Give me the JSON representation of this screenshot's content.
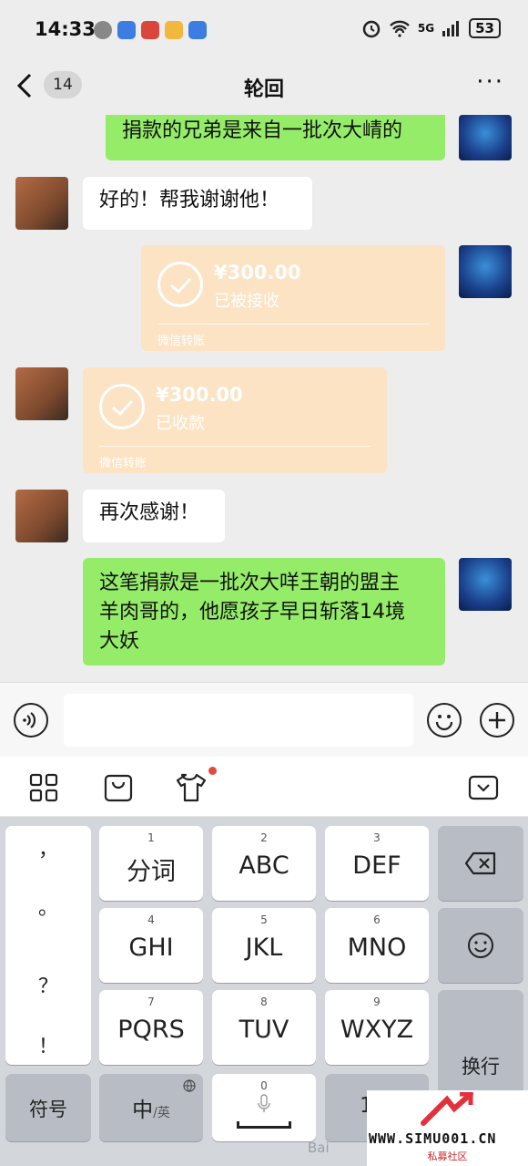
{
  "status_bar": {
    "time": "14:33",
    "network": "5G",
    "battery": "53"
  },
  "header": {
    "back_count": "14",
    "title": "轮回",
    "more": "···"
  },
  "messages": [
    {
      "side": "me",
      "type": "text",
      "text": "捐款的兄弟是来自一批次大崝的"
    },
    {
      "side": "other",
      "type": "text",
      "text": "好的！帮我谢谢他！"
    },
    {
      "side": "me",
      "type": "transfer",
      "amount": "¥300.00",
      "status": "已被接收",
      "source": "微信转账"
    },
    {
      "side": "other",
      "type": "transfer",
      "amount": "¥300.00",
      "status": "已收款",
      "source": "微信转账"
    },
    {
      "side": "other",
      "type": "text",
      "text": "再次感谢！"
    },
    {
      "side": "me",
      "type": "text",
      "lines": [
        "这笔捐款是一批次大咩王朝的盟主",
        "羊肉哥的，他愿孩子早日斩落14境",
        "大妖"
      ]
    }
  ],
  "keyboard": {
    "punct": [
      "，",
      "。",
      "？",
      "！"
    ],
    "keys": [
      {
        "num": "1",
        "label": "分词"
      },
      {
        "num": "2",
        "label": "ABC"
      },
      {
        "num": "3",
        "label": "DEF"
      },
      {
        "num": "4",
        "label": "GHI"
      },
      {
        "num": "5",
        "label": "JKL"
      },
      {
        "num": "6",
        "label": "MNO"
      },
      {
        "num": "7",
        "label": "PQRS"
      },
      {
        "num": "8",
        "label": "TUV"
      },
      {
        "num": "9",
        "label": "WXYZ"
      }
    ],
    "symbol": "符号",
    "lang_main": "中",
    "lang_sub": "/英",
    "space_num": "0",
    "newline": "换行",
    "partial_key": "1"
  },
  "watermark": {
    "url": "WWW.SIMU001.CN",
    "sub": "私募社区",
    "baidu": "Bai"
  },
  "colors": {
    "green_bubble": "#95ec69",
    "transfer": "#fbe3c4",
    "bg": "#ededed"
  }
}
